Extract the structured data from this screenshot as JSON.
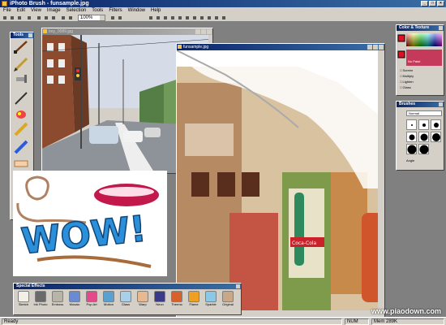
{
  "app": {
    "title": "iPhoto Brush - funsample.jpg"
  },
  "menu": [
    "File",
    "Edit",
    "View",
    "Image",
    "Selection",
    "Tools",
    "Filters",
    "Window",
    "Help"
  ],
  "toolbar": {
    "zoom_value": "100%"
  },
  "tools_panel": {
    "title": "Tools"
  },
  "doc_back": {
    "title": "boy_0089.jpg"
  },
  "doc_front": {
    "title": "funsample.jpg"
  },
  "canvas_art": {
    "wow_text": "WOW!",
    "bottle_text": "Coca-Cola"
  },
  "color_panel": {
    "title": "Color & Texture",
    "texture_label": "No Paint",
    "options": [
      "Screen",
      "Multiply",
      "Lighten",
      "Glass"
    ]
  },
  "brushes_panel": {
    "title": "Brushes",
    "mode_value": "Normal",
    "size_label": "Angle"
  },
  "effects_panel": {
    "title": "Special Effects",
    "items": [
      "Sketch",
      "Ink Photo",
      "Emboss",
      "Mosaic",
      "Pop Art",
      "Motion",
      "Glass",
      "Warp",
      "Neon",
      "Thermo",
      "Flame",
      "Sparkle",
      "Original"
    ]
  },
  "status": {
    "left": "Ready",
    "mode": "NUM",
    "memory": "Mem 289K"
  },
  "watermark": "www.piaodown.com"
}
